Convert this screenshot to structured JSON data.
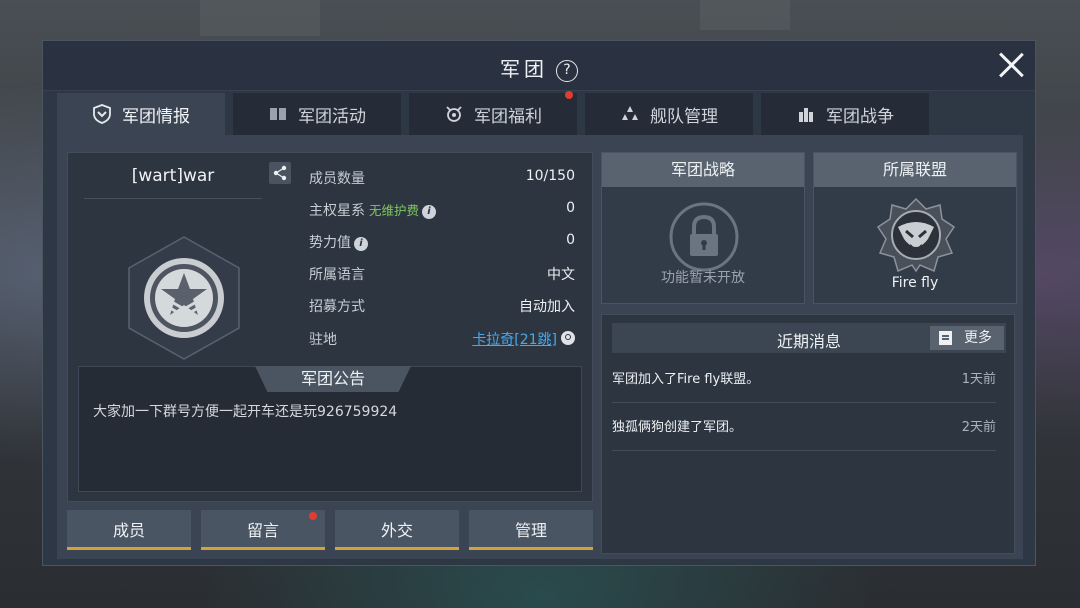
{
  "window": {
    "title": "军团",
    "help_icon": "question-icon",
    "close_icon": "close-icon"
  },
  "tabs": [
    {
      "label": "军团情报",
      "icon": "shield-icon",
      "active": true,
      "badge": false
    },
    {
      "label": "军团活动",
      "icon": "book-icon",
      "active": false,
      "badge": false
    },
    {
      "label": "军团福利",
      "icon": "gift-icon",
      "active": false,
      "badge": true
    },
    {
      "label": "舰队管理",
      "icon": "fleet-icon",
      "active": false,
      "badge": false
    },
    {
      "label": "军团战争",
      "icon": "castle-icon",
      "active": false,
      "badge": false
    }
  ],
  "guild": {
    "name": "[wart]war",
    "share_icon": "share-icon",
    "stats": [
      {
        "label": "成员数量",
        "value": "10/150"
      },
      {
        "label": "主权星系",
        "note": "无维护费",
        "value": "0"
      },
      {
        "label": "势力值",
        "value": "0"
      },
      {
        "label": "所属语言",
        "value": "中文"
      },
      {
        "label": "招募方式",
        "value": "自动加入"
      },
      {
        "label": "驻地",
        "value": "卡拉奇[21跳]"
      }
    ],
    "notice_title": "军团公告",
    "notice_text": "大家加一下群号方便一起开车还是玩926759924"
  },
  "buttons": [
    {
      "label": "成员",
      "badge": false
    },
    {
      "label": "留言",
      "badge": true
    },
    {
      "label": "外交",
      "badge": false
    },
    {
      "label": "管理",
      "badge": false
    }
  ],
  "strategy": {
    "title": "军团战略",
    "caption": "功能暂未开放",
    "icon": "lock-icon"
  },
  "alliance": {
    "title": "所属联盟",
    "name": "Fire fly",
    "icon": "alliance-emblem-icon"
  },
  "news": {
    "title": "近期消息",
    "more_label": "更多",
    "items": [
      {
        "text": "军团加入了Fire fly联盟。",
        "time": "1天前"
      },
      {
        "text": "独孤俩狗创建了军团。",
        "time": "2天前"
      }
    ]
  },
  "colors": {
    "accent_gold": "#d4a23a",
    "badge_red": "#e03c31",
    "note_green": "#7ec860",
    "link_blue": "#49a9e8"
  }
}
